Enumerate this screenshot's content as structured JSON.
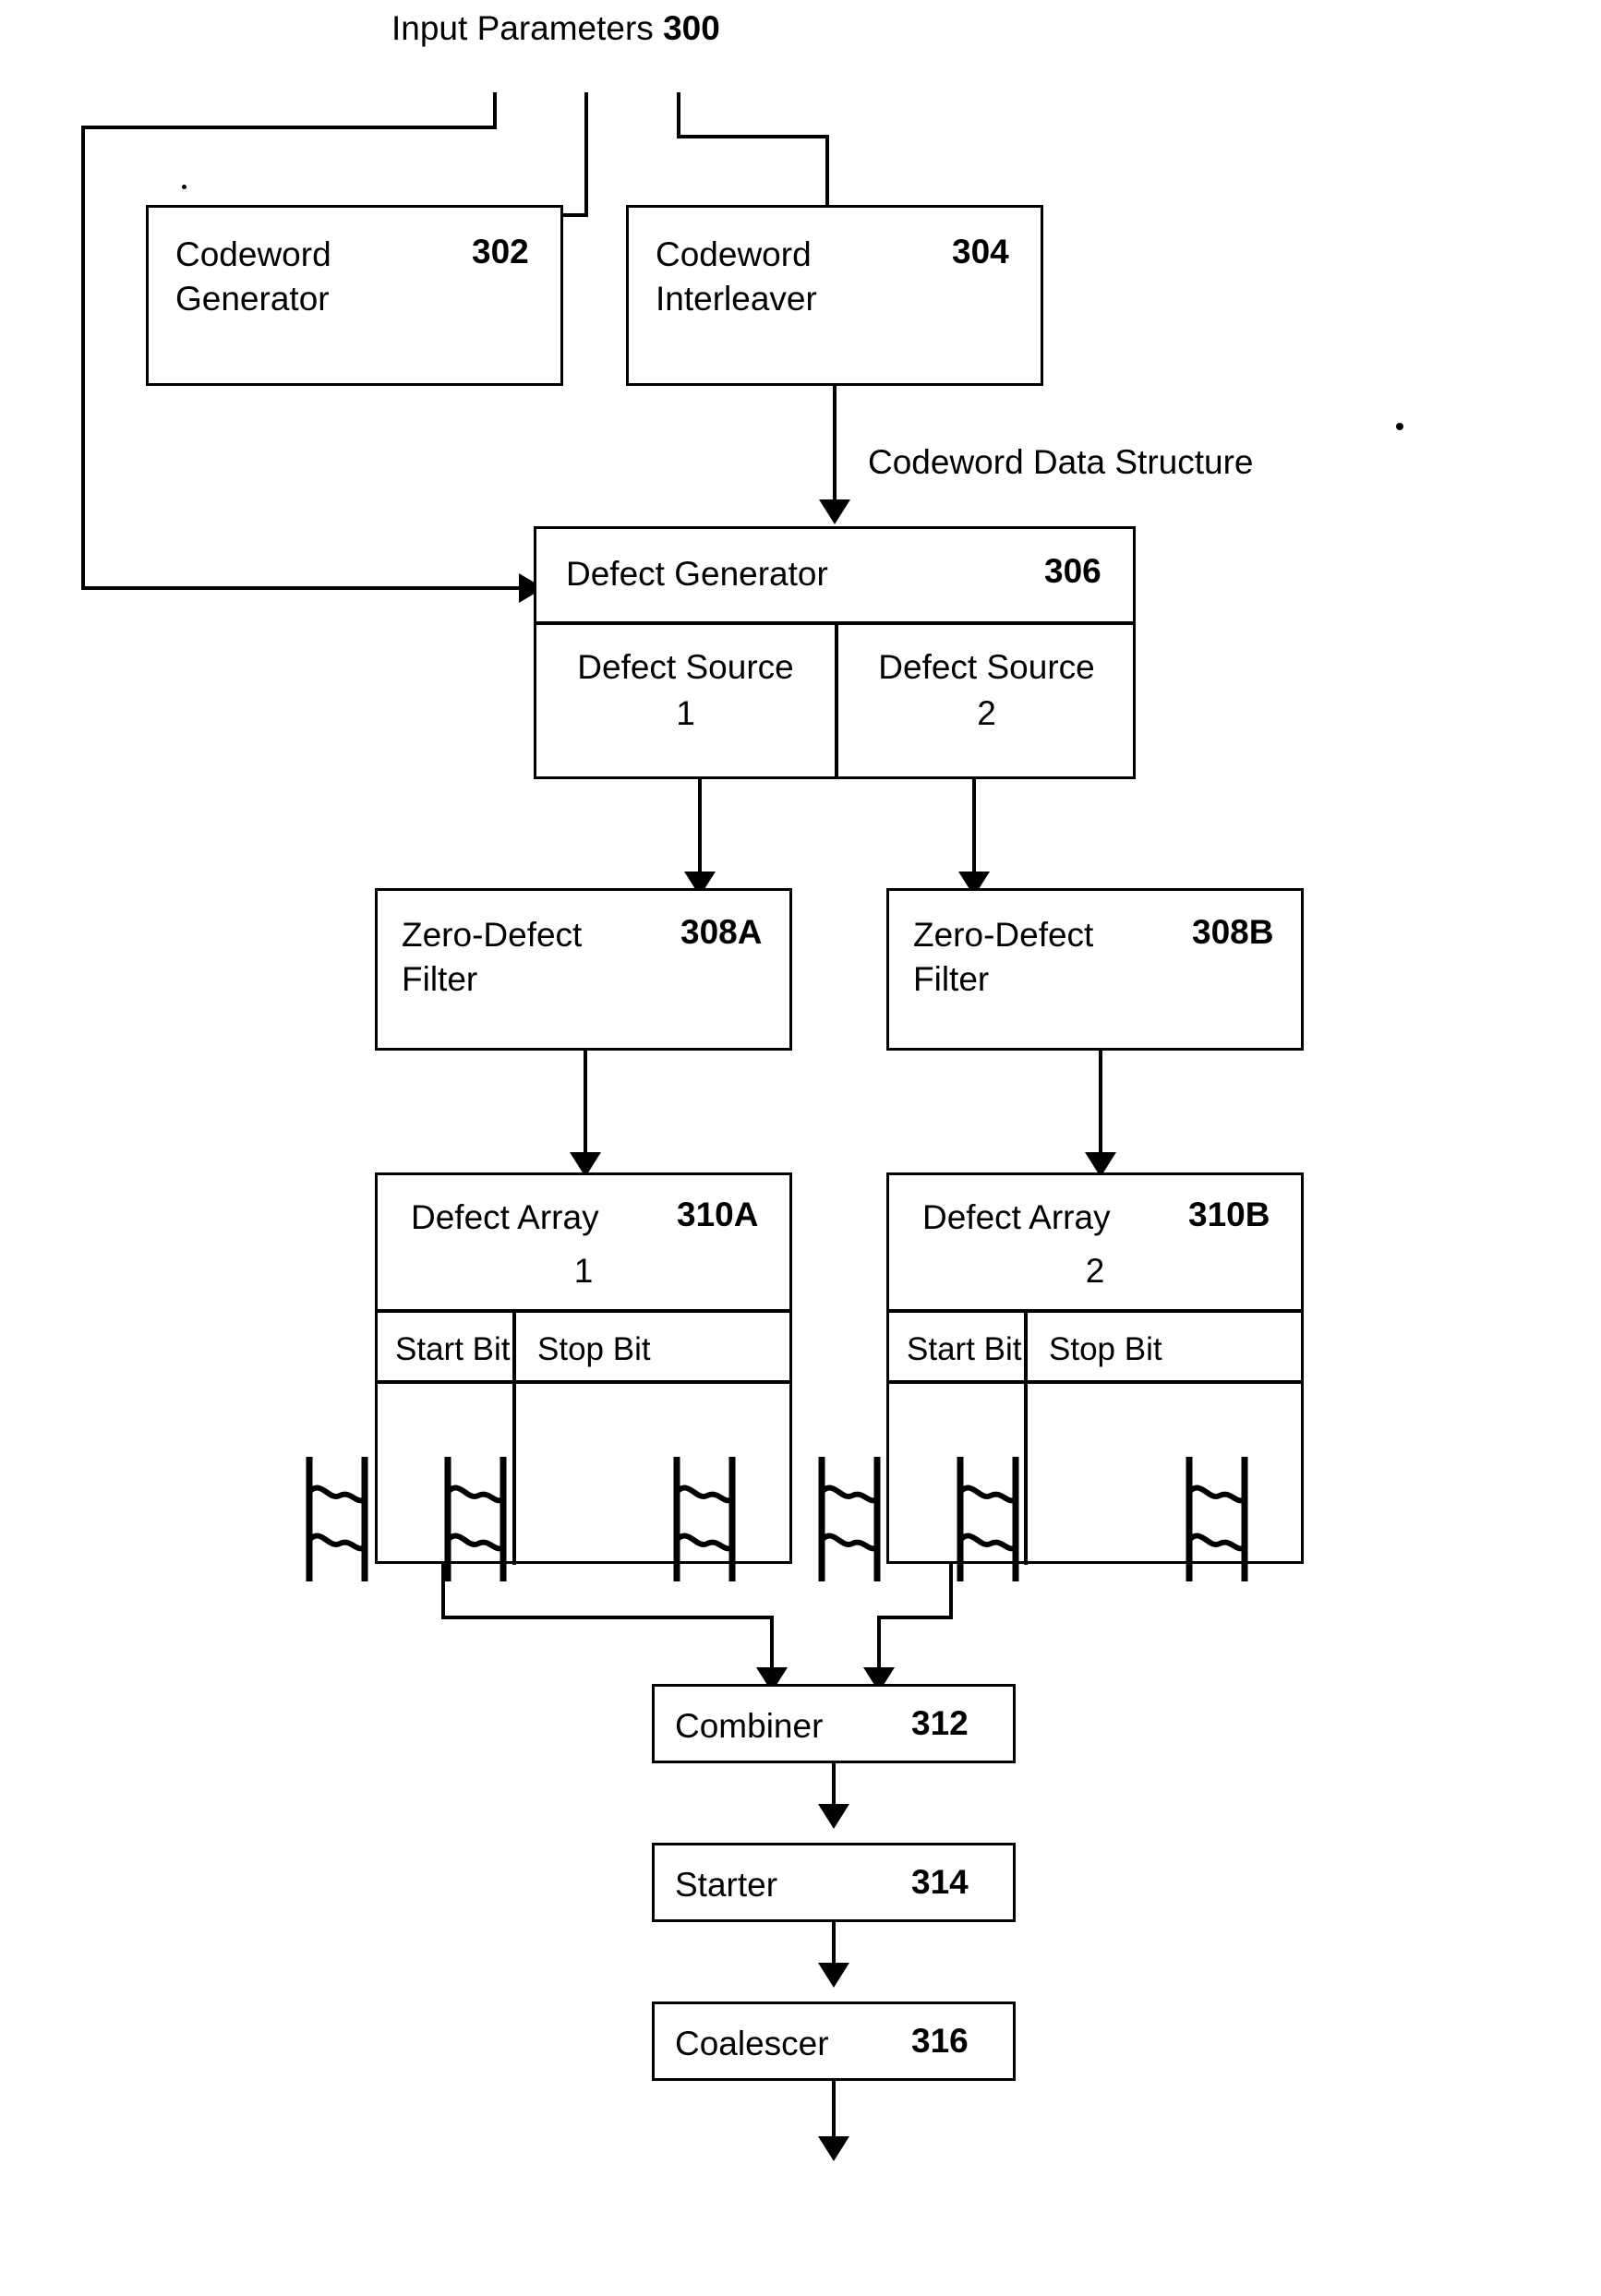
{
  "figure": {
    "input_label": "Input Parameters",
    "input_ref": "300",
    "codeword_data_structure_label": "Codeword Data Structure"
  },
  "blocks": {
    "codeword_generator": {
      "title": "Codeword\nGenerator",
      "ref": "302"
    },
    "codeword_interleaver": {
      "title": "Codeword\nInterleaver",
      "ref": "304"
    },
    "defect_generator": {
      "title": "Defect Generator",
      "ref": "306",
      "sources": [
        {
          "name": "Defect Source",
          "index": "1"
        },
        {
          "name": "Defect Source",
          "index": "2"
        }
      ]
    },
    "zero_defect_filter_a": {
      "title": "Zero-Defect\nFilter",
      "ref": "308A"
    },
    "zero_defect_filter_b": {
      "title": "Zero-Defect\nFilter",
      "ref": "308B"
    },
    "defect_array_a": {
      "title": "Defect Array",
      "ref": "310A",
      "index": "1",
      "columns": [
        "Start Bit",
        "Stop Bit"
      ]
    },
    "defect_array_b": {
      "title": "Defect Array",
      "ref": "310B",
      "index": "2",
      "columns": [
        "Start Bit",
        "Stop Bit"
      ]
    },
    "combiner": {
      "title": "Combiner",
      "ref": "312"
    },
    "starter": {
      "title": "Starter",
      "ref": "314"
    },
    "coalescer": {
      "title": "Coalescer",
      "ref": "316"
    }
  },
  "colors": {
    "stroke": "#000000",
    "background": "#ffffff"
  }
}
